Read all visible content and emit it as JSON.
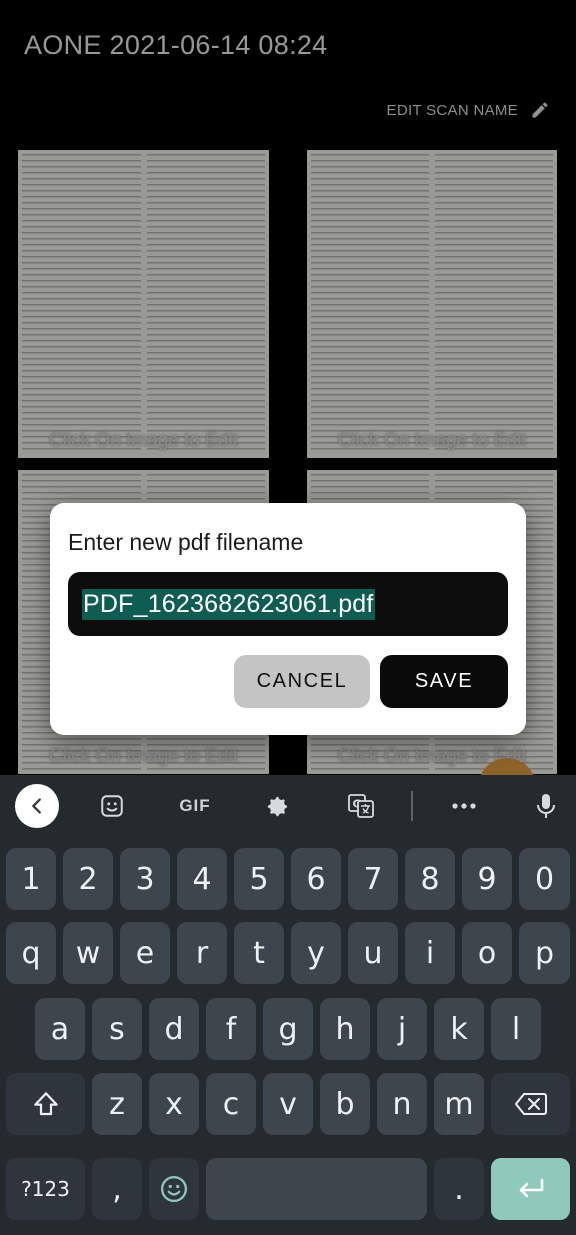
{
  "app": {
    "title": "AONE 2021-06-14 08:24",
    "edit_scan_name": "EDIT SCAN NAME"
  },
  "gallery": {
    "items": [
      {
        "caption": "Click On Image to Edit"
      },
      {
        "caption": "Click On Image to Edit"
      },
      {
        "caption": "Click On Image to Edit"
      },
      {
        "caption": "Click On Image to Edit"
      }
    ]
  },
  "dialog": {
    "title": "Enter new pdf filename",
    "filename": "PDF_1623682623061.pdf",
    "cancel_label": "CANCEL",
    "save_label": "SAVE"
  },
  "keyboard": {
    "toolbar": {
      "gif_label": "GIF",
      "icons": [
        "back-chevron-icon",
        "sticker-icon",
        "gear-icon",
        "translate-icon",
        "more-icon",
        "mic-icon"
      ]
    },
    "number_row": [
      "1",
      "2",
      "3",
      "4",
      "5",
      "6",
      "7",
      "8",
      "9",
      "0"
    ],
    "row1": [
      "q",
      "w",
      "e",
      "r",
      "t",
      "y",
      "u",
      "i",
      "o",
      "p"
    ],
    "row2": [
      "a",
      "s",
      "d",
      "f",
      "g",
      "h",
      "j",
      "k",
      "l"
    ],
    "row3": [
      "z",
      "x",
      "c",
      "v",
      "b",
      "n",
      "m"
    ],
    "bottom": {
      "symbols_label": "?123",
      "comma": ",",
      "period": "."
    },
    "colors": {
      "enter": "#8ec9bc",
      "key": "#3d454d",
      "background": "#252a2f"
    }
  }
}
